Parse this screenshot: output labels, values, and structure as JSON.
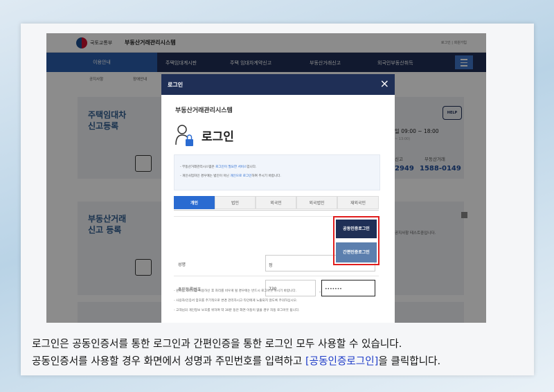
{
  "site": {
    "ministry": "국토교통부",
    "system_name": "부동산거래관리시스템",
    "top_links": [
      "로그인",
      "회원가입"
    ],
    "nav": [
      "이용안내",
      "주택임대계시판",
      "주택 임대차계약신고",
      "부동산거래신고",
      "외국인부동산취득"
    ],
    "subnav": [
      "공지사항",
      "장애안내"
    ],
    "panel1_title_line1": "주택임대차",
    "panel1_title_line2": "신고등록",
    "panel2_title_line1": "부동산거래",
    "panel2_title_line2": "신고 등록",
    "hours": "일 09:00 ~ 18:00",
    "hours_sub": "~ 13:00)",
    "contact_label1": "신고",
    "contact_label2": "부동산거래",
    "contact_num1": "2949",
    "contact_num2": "1588-0149",
    "notice_snippet": "공지사항 테스트중입니다.",
    "help_label": "HELP"
  },
  "modal": {
    "title": "로그인",
    "close": "×",
    "system_label": "부동산거래관리시스템",
    "heading": "로그인",
    "notice_line1_pre": "- 부동산거래관리시스템은 ",
    "notice_line1_hl": "로그인이 필요한 서비스",
    "notice_line1_post": "입니다.",
    "notice_line2_pre": "- 개인사업자인 경우에는 법인이 아닌 ",
    "notice_line2_hl": "개인으로 로그인",
    "notice_line2_post": "하여 주시기 바랍니다.",
    "tabs": [
      "개인",
      "법인",
      "외국인",
      "외국법인",
      "재외국민"
    ],
    "name_label": "성명",
    "name_value": "정",
    "rrn_label": "주민등록번호",
    "rrn_front": "730",
    "rrn_dash": "-",
    "rrn_back": "•••••••",
    "cert_button": "공동인증로그인",
    "simple_button": "간편인증로그인",
    "footer_notes": [
      "- 원하는 서비스를 이용하신 후 자리를 비우게 될 경우에는 반드시 로그아웃 하시기 바랍니다.",
      "- 사용자/인증서 암호를 주기적으로 변경 관리하시고 타인에게 노출되지 않도록 주의하십시오.",
      "- 고객님의 개인정보 보호를 위하여 약 30분 동안 화면 이동이 없을 경우 자동 로그아웃 됩니다."
    ]
  },
  "caption": {
    "line1": "로그인은 공동인증서를 통한 로그인과 간편인증을 통한 로그인 모두 사용할 수 있습니다.",
    "line2_pre": "공동인증서를 사용할 경우 화면에서 성명과 주민번호를 입력하고 ",
    "line2_link": "[공동인증로그인]",
    "line2_post": "을 클릭합니다."
  },
  "colors": {
    "nav": "#1f2f56",
    "accent": "#2a6bd1",
    "highlight_box": "#e01d1d",
    "caption_link": "#1e3cc8"
  }
}
